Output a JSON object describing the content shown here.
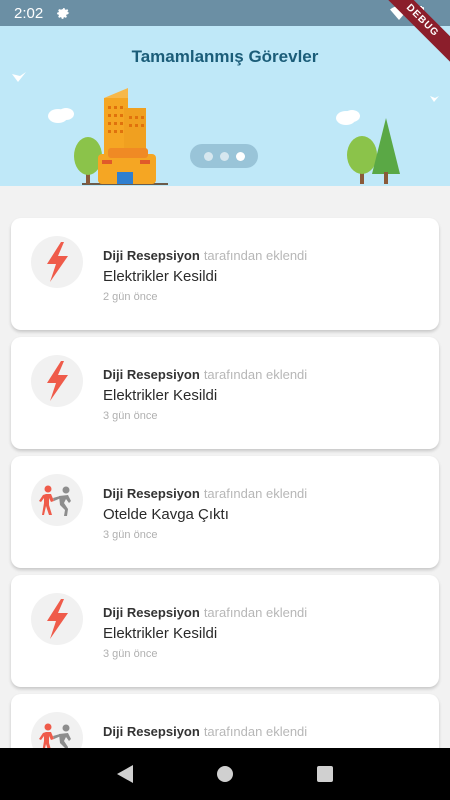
{
  "status_bar": {
    "time": "2:02",
    "debug_label": "DEBUG"
  },
  "header": {
    "title": "Tamamlanmış Görevler"
  },
  "pager": {
    "count": 3,
    "active_index": 2
  },
  "tasks": [
    {
      "author": "Diji Resepsiyon",
      "suffix": "tarafından eklendi",
      "title": "Elektrikler Kesildi",
      "time": "2 gün önce",
      "icon": "lightning-icon"
    },
    {
      "author": "Diji Resepsiyon",
      "suffix": "tarafından eklendi",
      "title": "Elektrikler Kesildi",
      "time": "3 gün önce",
      "icon": "lightning-icon"
    },
    {
      "author": "Diji Resepsiyon",
      "suffix": "tarafından eklendi",
      "title": "Otelde Kavga Çıktı",
      "time": "3 gün önce",
      "icon": "fight-icon"
    },
    {
      "author": "Diji Resepsiyon",
      "suffix": "tarafından eklendi",
      "title": "Elektrikler Kesildi",
      "time": "3 gün önce",
      "icon": "lightning-icon"
    },
    {
      "author": "Diji Resepsiyon",
      "suffix": "tarafından eklendi",
      "title": "",
      "time": "",
      "icon": "fight-icon"
    }
  ],
  "colors": {
    "banner_bg": "#bfe8f8",
    "title": "#1b5d79",
    "lightning": "#ef5b4a",
    "status_bar": "#6b8fa4"
  }
}
